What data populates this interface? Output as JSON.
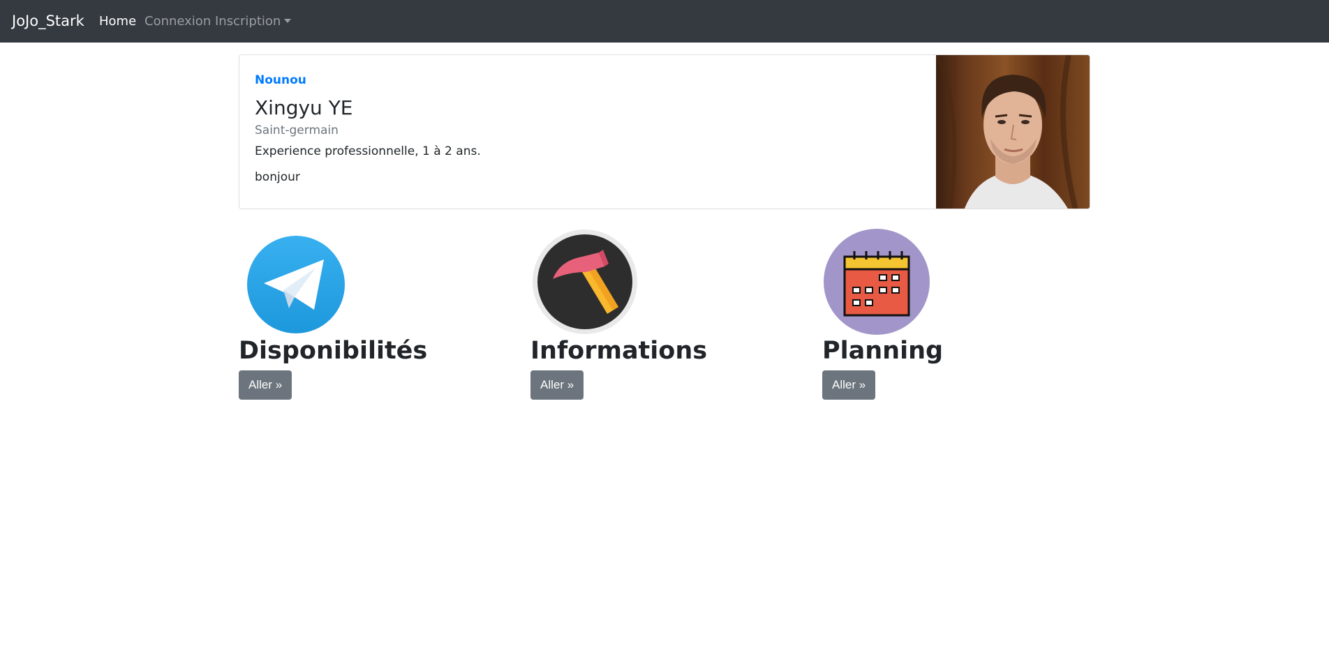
{
  "navbar": {
    "brand": "JoJo_Stark",
    "items": [
      {
        "label": "Home",
        "active": true
      },
      {
        "label": "Connexion",
        "active": false
      },
      {
        "label": "Inscription",
        "active": false,
        "dropdown": true
      }
    ]
  },
  "profile": {
    "role": "Nounou",
    "name": "Xingyu YE",
    "city": "Saint-germain",
    "experience": "Experience professionnelle, 1 à 2 ans.",
    "message": "bonjour"
  },
  "features": [
    {
      "title": "Disponibilités",
      "button": "Aller »",
      "icon": "telegram-icon"
    },
    {
      "title": "Informations",
      "button": "Aller »",
      "icon": "hammer-icon"
    },
    {
      "title": "Planning",
      "button": "Aller »",
      "icon": "calendar-icon"
    }
  ],
  "colors": {
    "navbar_bg": "#343a40",
    "link_blue": "#007bff",
    "button_grey": "#6c757d",
    "telegram_blue": "#2aabee",
    "calendar_purple": "#a295c9"
  }
}
